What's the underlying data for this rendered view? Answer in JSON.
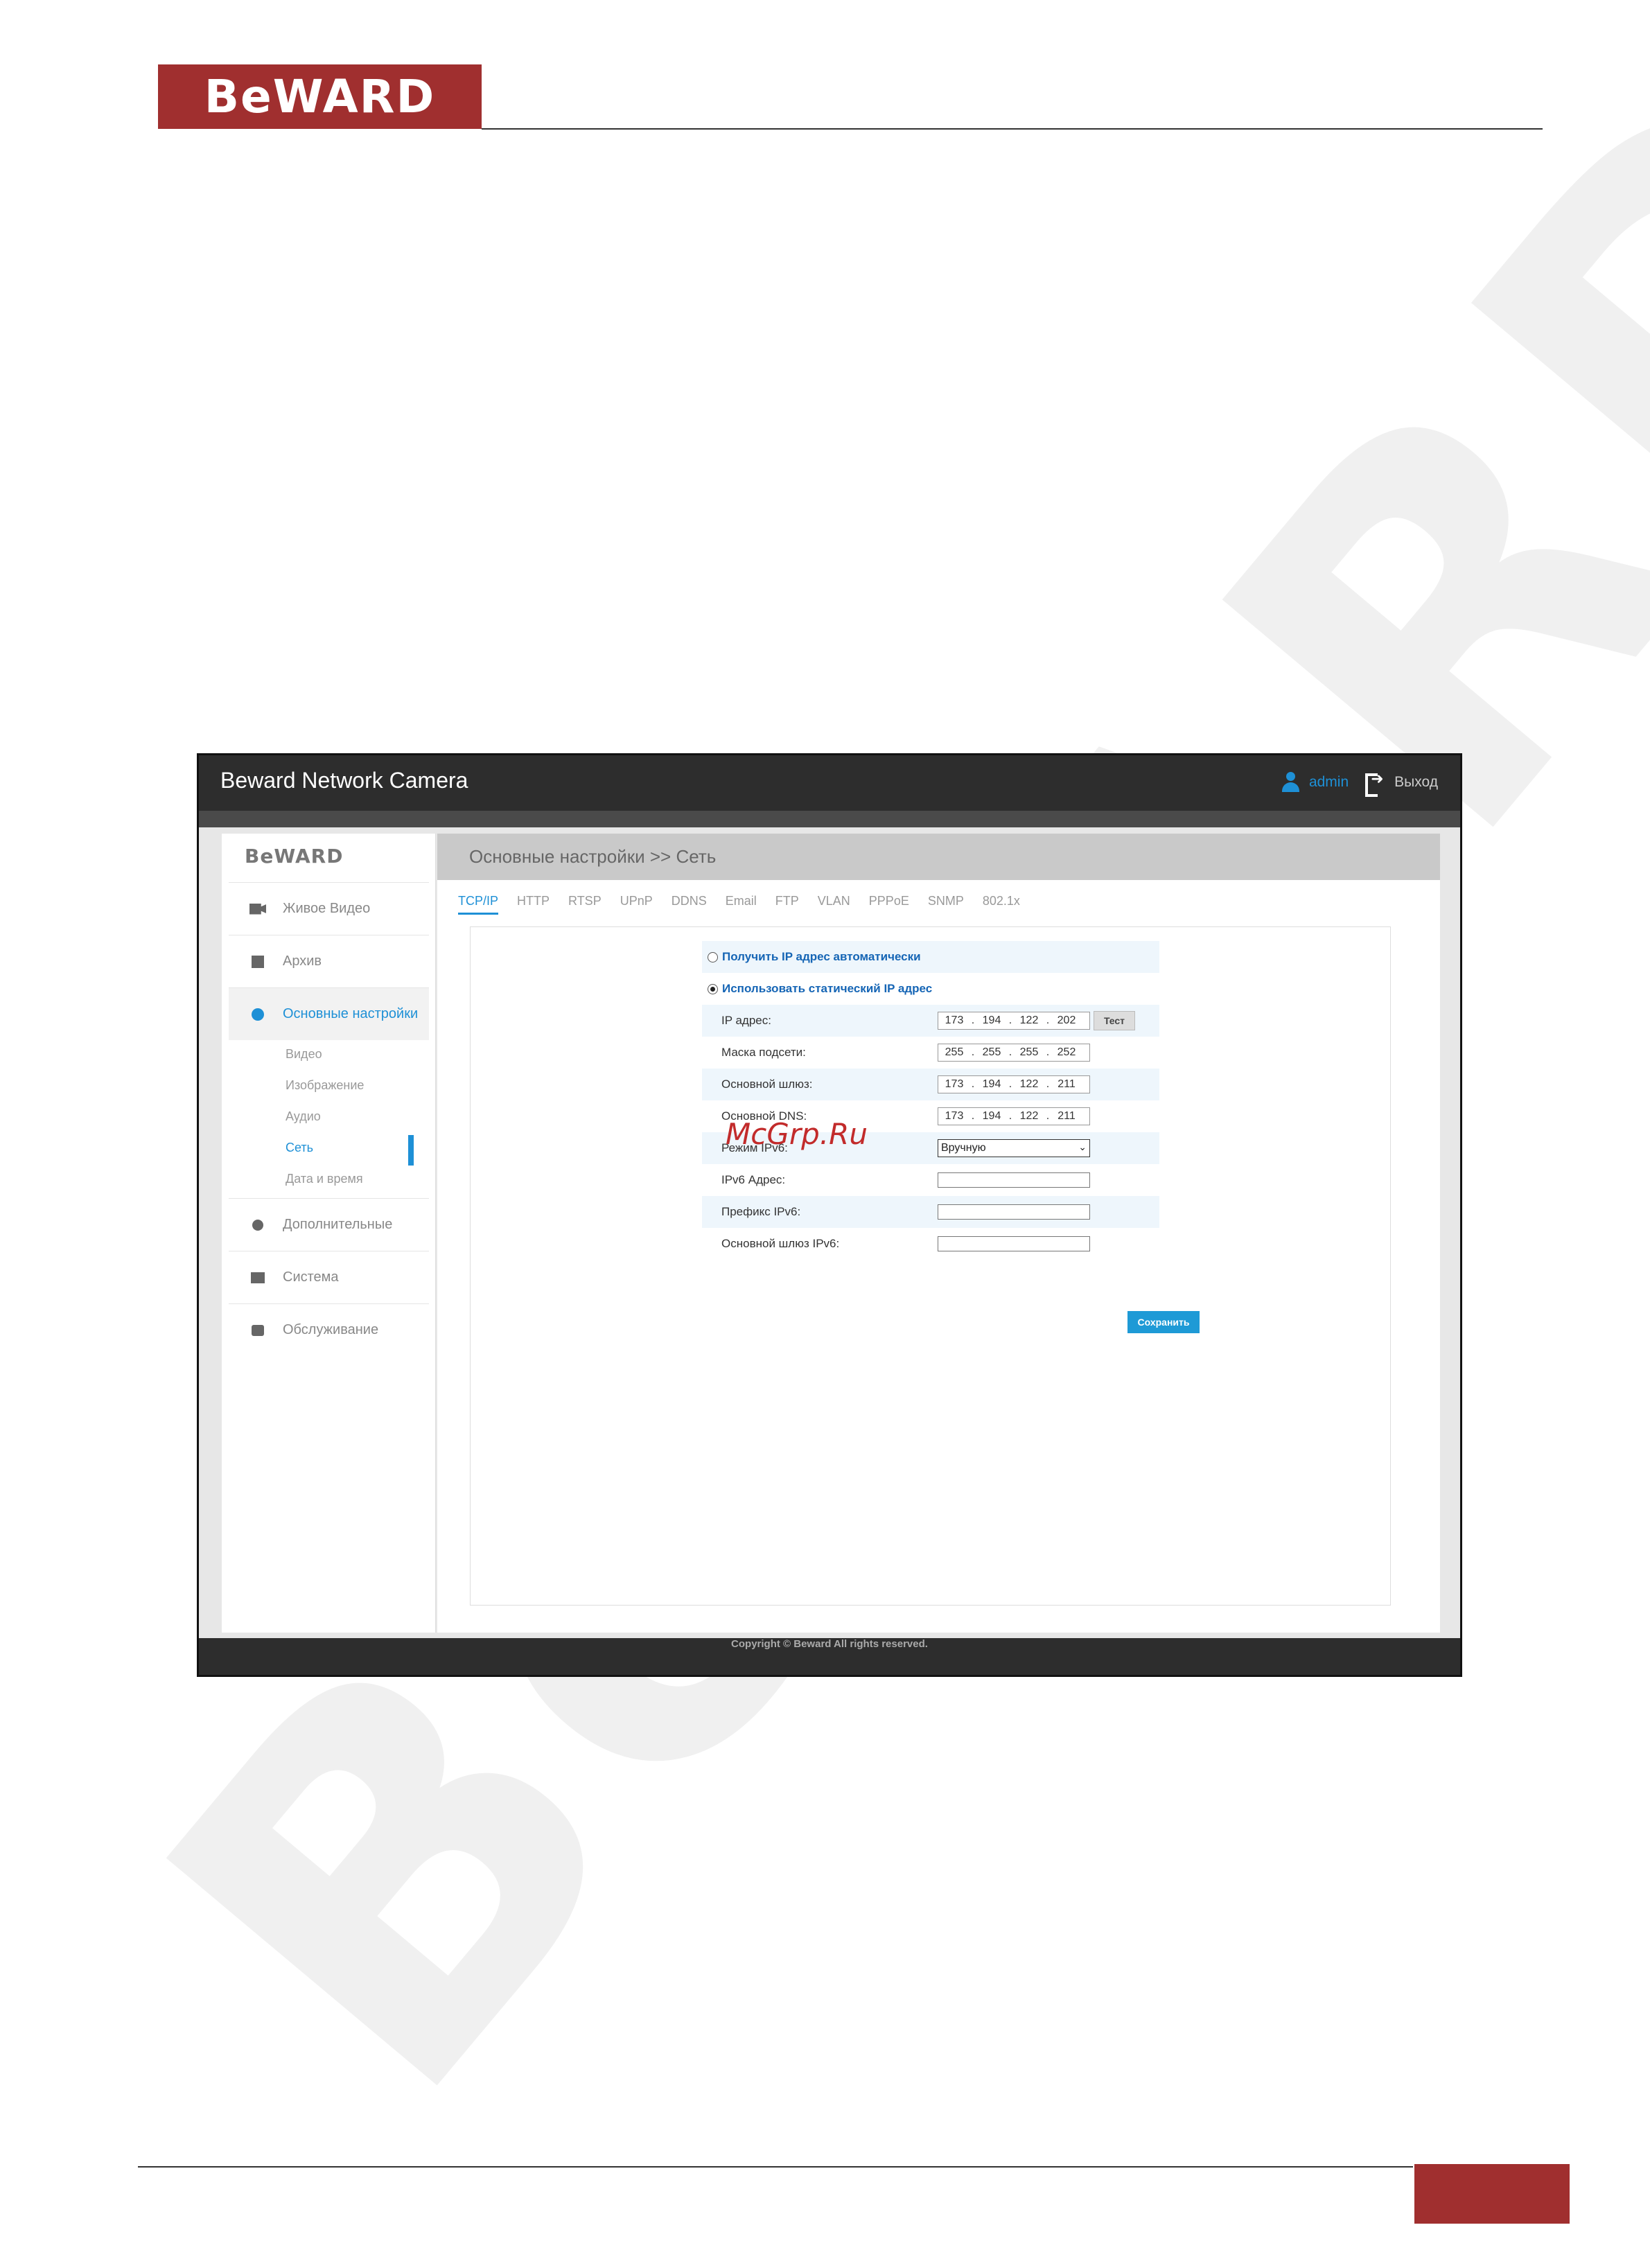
{
  "document": {
    "logo_text": "BeWARD"
  },
  "app": {
    "title": "Beward Network Camera",
    "user": "admin",
    "logout": "Выход",
    "copyright": "Copyright © Beward All rights reserved.",
    "accent_color": "#1e90d6"
  },
  "sidebar": {
    "logo": "BeWARD",
    "items": [
      {
        "label": "Живое Видео",
        "icon": "video-camera-icon"
      },
      {
        "label": "Архив",
        "icon": "archive-icon"
      },
      {
        "label": "Основные настройки",
        "icon": "gear-icon"
      },
      {
        "label": "Дополнительные",
        "icon": "gears-icon"
      },
      {
        "label": "Система",
        "icon": "monitor-icon"
      },
      {
        "label": "Обслуживание",
        "icon": "camera-icon"
      }
    ],
    "subitems": [
      "Видео",
      "Изображение",
      "Аудио",
      "Сеть",
      "Дата и время"
    ]
  },
  "main": {
    "breadcrumb": "Основные настройки >> Сеть",
    "tabs": [
      "TCP/IP",
      "HTTP",
      "RTSP",
      "UPnP",
      "DDNS",
      "Email",
      "FTP",
      "VLAN",
      "PPPoE",
      "SNMP",
      "802.1x"
    ]
  },
  "form": {
    "radio_auto": "Получить IP адрес автоматически",
    "radio_static": "Использовать статический IP адрес",
    "ip_label": "IP адрес:",
    "ip": [
      "173",
      "194",
      "122",
      "202"
    ],
    "test_button": "Тест",
    "mask_label": "Маска подсети:",
    "mask": [
      "255",
      "255",
      "255",
      "252"
    ],
    "gateway_label": "Основной шлюз:",
    "gateway": [
      "173",
      "194",
      "122",
      "211"
    ],
    "dns_label": "Основной DNS:",
    "dns": [
      "173",
      "194",
      "122",
      "211"
    ],
    "ipv6_mode_label": "Режим IPv6:",
    "ipv6_mode_value": "Вручную",
    "ipv6_addr_label": "IPv6 Адрес:",
    "ipv6_prefix_label": "Префикс IPv6:",
    "ipv6_gateway_label": "Основной шлюз IPv6:",
    "save_button": "Сохранить"
  },
  "overlay": {
    "watermark_site": "McGrp.Ru"
  }
}
